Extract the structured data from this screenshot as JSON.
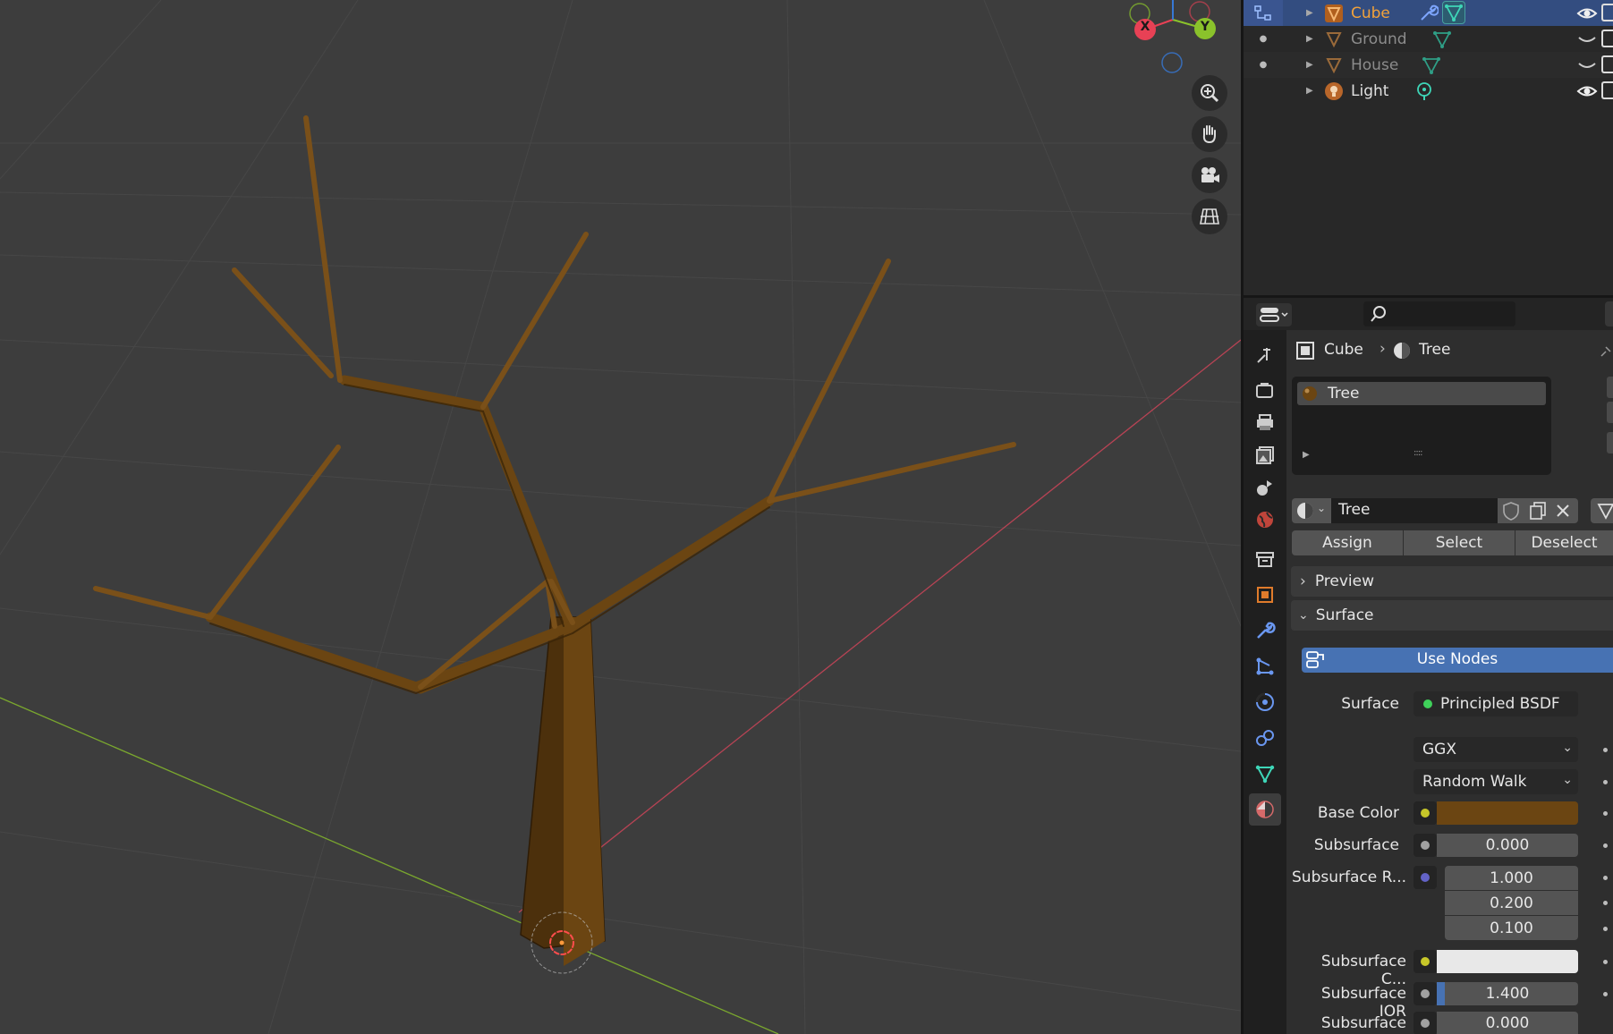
{
  "viewport": {
    "gizmo": {
      "x_label": "X",
      "y_label": "Y"
    },
    "colors": {
      "x_axis": "#e84155",
      "y_axis": "#8ac22b",
      "z_axis": "#3778d5",
      "bark": "#6b4512",
      "background": "#3d3d3d"
    }
  },
  "outliner": {
    "items": [
      {
        "name": "Cube",
        "selected": true,
        "color": "#f2a23a",
        "eye_visible": true
      },
      {
        "name": "Ground",
        "selected": false,
        "color": "#8c8c8c",
        "eye_visible": false
      },
      {
        "name": "House",
        "selected": false,
        "color": "#8c8c8c",
        "eye_visible": false
      },
      {
        "name": "Light",
        "selected": false,
        "color": "#e0e0e0",
        "eye_visible": true
      }
    ]
  },
  "properties": {
    "breadcrumb": {
      "object": "Cube",
      "material": "Tree"
    },
    "material_slots": [
      {
        "name": "Tree"
      }
    ],
    "material_name": "Tree",
    "slot_buttons": {
      "assign": "Assign",
      "select": "Select",
      "deselect": "Deselect"
    },
    "panels": {
      "preview": "Preview",
      "surface": "Surface"
    },
    "use_nodes_label": "Use Nodes",
    "surface": {
      "surface_label": "Surface",
      "surface_value": "Principled BSDF",
      "distribution": "GGX",
      "subsurface_method": "Random Walk",
      "base_color_label": "Base Color",
      "base_color": "#6b4512",
      "subsurface_label": "Subsurface",
      "subsurface_value": "0.000",
      "subsurface_radius_label": "Subsurface R...",
      "subsurface_radius": [
        "1.000",
        "0.200",
        "0.100"
      ],
      "subsurface_color_label": "Subsurface C...",
      "subsurface_color": "#e8e8e8",
      "subsurface_ior_label": "Subsurface IOR",
      "subsurface_ior_value": "1.400",
      "subsurface_ior_fill": 0.056,
      "subsurface_aniso_label": "Subsurface A...",
      "subsurface_aniso_value": "0.000"
    }
  }
}
